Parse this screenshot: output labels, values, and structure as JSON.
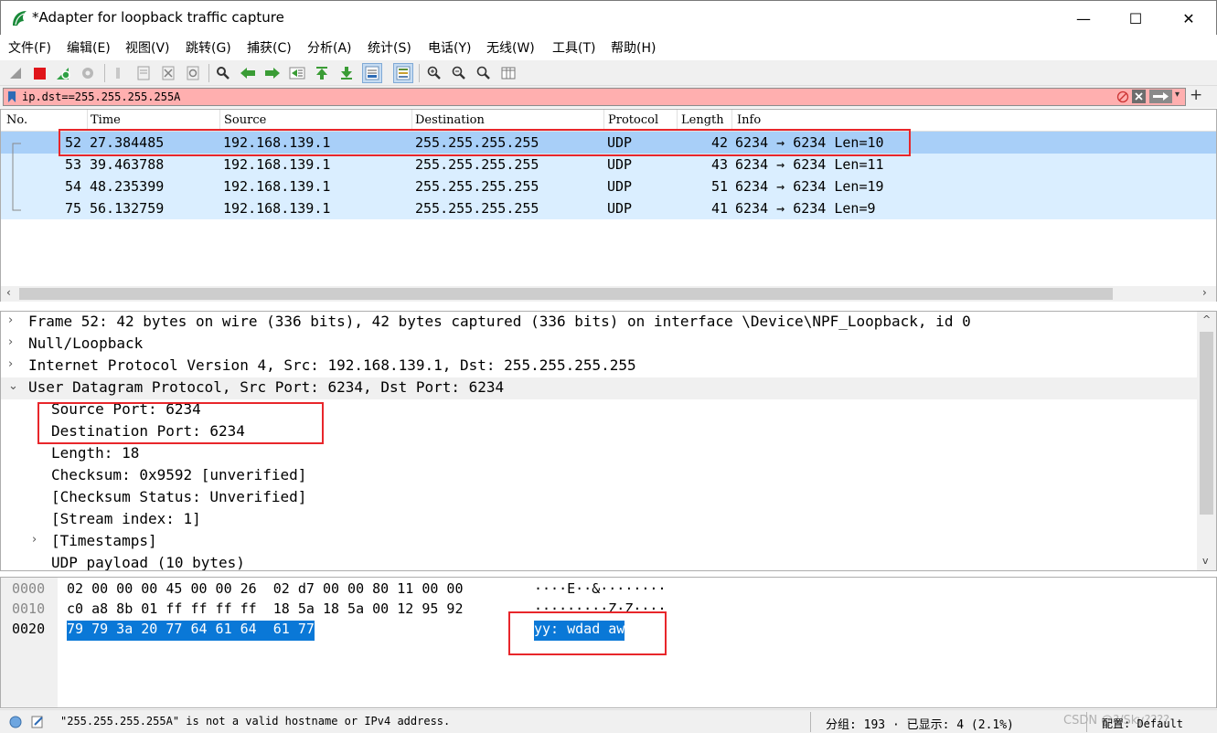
{
  "window": {
    "title": "*Adapter for loopback traffic capture",
    "minimize": "—",
    "maximize": "☐",
    "close": "✕"
  },
  "menu": [
    "文件(F)",
    "编辑(E)",
    "视图(V)",
    "跳转(G)",
    "捕获(C)",
    "分析(A)",
    "统计(S)",
    "电话(Y)",
    "无线(W)",
    "工具(T)",
    "帮助(H)"
  ],
  "filter": {
    "value": "ip.dst==255.255.255.255A",
    "plus": "+",
    "background": "#ffafaf"
  },
  "packet_list": {
    "columns": [
      "No.",
      "Time",
      "Source",
      "Destination",
      "Protocol",
      "Length",
      "Info"
    ],
    "rows": [
      {
        "no": "52",
        "time": "27.384485",
        "src": "192.168.139.1",
        "dst": "255.255.255.255",
        "proto": "UDP",
        "len": "42",
        "info": "6234 → 6234 Len=10",
        "selected": true
      },
      {
        "no": "53",
        "time": "39.463788",
        "src": "192.168.139.1",
        "dst": "255.255.255.255",
        "proto": "UDP",
        "len": "43",
        "info": "6234 → 6234 Len=11",
        "selected": false
      },
      {
        "no": "54",
        "time": "48.235399",
        "src": "192.168.139.1",
        "dst": "255.255.255.255",
        "proto": "UDP",
        "len": "51",
        "info": "6234 → 6234 Len=19",
        "selected": false
      },
      {
        "no": "75",
        "time": "56.132759",
        "src": "192.168.139.1",
        "dst": "255.255.255.255",
        "proto": "UDP",
        "len": "41",
        "info": "6234 → 6234 Len=9",
        "selected": false
      }
    ],
    "colors": {
      "selected": "#a8cff8",
      "row": "#daeeff"
    }
  },
  "details": [
    {
      "arrow": "›",
      "text": "Frame 52: 42 bytes on wire (336 bits), 42 bytes captured (336 bits) on interface \\Device\\NPF_Loopback, id 0",
      "level": 0
    },
    {
      "arrow": "›",
      "text": "Null/Loopback",
      "level": 0
    },
    {
      "arrow": "›",
      "text": "Internet Protocol Version 4, Src: 192.168.139.1, Dst: 255.255.255.255",
      "level": 0
    },
    {
      "arrow": "⌄",
      "text": "User Datagram Protocol, Src Port: 6234, Dst Port: 6234",
      "level": 0
    },
    {
      "arrow": "",
      "text": "Source Port: 6234",
      "level": 1
    },
    {
      "arrow": "",
      "text": "Destination Port: 6234",
      "level": 1
    },
    {
      "arrow": "",
      "text": "Length: 18",
      "level": 1
    },
    {
      "arrow": "",
      "text": "Checksum: 0x9592 [unverified]",
      "level": 1
    },
    {
      "arrow": "",
      "text": "[Checksum Status: Unverified]",
      "level": 1
    },
    {
      "arrow": "",
      "text": "[Stream index: 1]",
      "level": 1
    },
    {
      "arrow": "›",
      "text": "[Timestamps]",
      "level": 1
    },
    {
      "arrow": "",
      "text": "UDP payload (10 bytes)",
      "level": 1
    }
  ],
  "bytes": [
    {
      "offset": "0000",
      "hex": "02 00 00 00 45 00 00 26  02 d7 00 00 80 11 00 00",
      "ascii": "····E··&········"
    },
    {
      "offset": "0010",
      "hex": "c0 a8 8b 01 ff ff ff ff  18 5a 18 5a 00 12 95 92",
      "ascii": "·········Z·Z····"
    },
    {
      "offset": "0020",
      "hex": "79 79 3a 20 77 64 61 64  61 77",
      "ascii": "yy: wdad aw"
    }
  ],
  "status": {
    "message": "\"255.255.255.255A\" is not a valid hostname or IPv4 address.",
    "packets": "分组: 193 · 已显示: 4 (2.1%)",
    "profile": "配置: Default",
    "watermark": "CSDN @?/Sky????"
  }
}
